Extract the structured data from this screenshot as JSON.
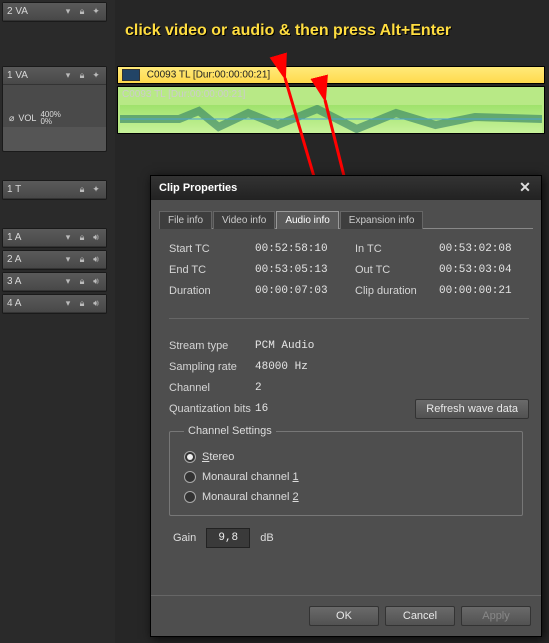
{
  "annotation": "click video or audio & then press Alt+Enter",
  "tracks": {
    "t2va": "2 VA",
    "t1va": "1 VA",
    "vol": "VOL",
    "vol_pct_top": "400%",
    "vol_pct_bot": "0%",
    "t1t": "1 T",
    "t1a": "1 A",
    "t2a": "2 A",
    "t3a": "3 A",
    "t4a": "4 A"
  },
  "clips": {
    "video_label": "C0093  TL [Dur:00:00:00:21]",
    "audio_label": "C0093  TL [Dur:00:00:00:21]"
  },
  "dialog": {
    "title": "Clip Properties",
    "tabs": {
      "file": "File info",
      "video": "Video info",
      "audio": "Audio info",
      "expansion": "Expansion info"
    },
    "fields": {
      "start_tc_l": "Start TC",
      "start_tc_v": "00:52:58:10",
      "in_tc_l": "In TC",
      "in_tc_v": "00:53:02:08",
      "end_tc_l": "End TC",
      "end_tc_v": "00:53:05:13",
      "out_tc_l": "Out TC",
      "out_tc_v": "00:53:03:04",
      "duration_l": "Duration",
      "duration_v": "00:00:07:03",
      "clipdur_l": "Clip duration",
      "clipdur_v": "00:00:00:21",
      "stream_l": "Stream type",
      "stream_v": "PCM Audio",
      "sample_l": "Sampling rate",
      "sample_v": "48000 Hz",
      "channel_l": "Channel",
      "channel_v": "2",
      "quant_l": "Quantization bits",
      "quant_v": "16"
    },
    "refresh": "Refresh wave data",
    "channel_settings": {
      "legend": "Channel Settings",
      "stereo_pre": "S",
      "stereo_rest": "tereo",
      "mono1_pre": "Monaural channel ",
      "mono1_key": "1",
      "mono2_pre": "Monaural channel ",
      "mono2_key": "2"
    },
    "gain_label": "Gain",
    "gain_value": "9,8",
    "gain_unit": "dB",
    "buttons": {
      "ok": "OK",
      "cancel": "Cancel",
      "apply": "Apply"
    }
  }
}
